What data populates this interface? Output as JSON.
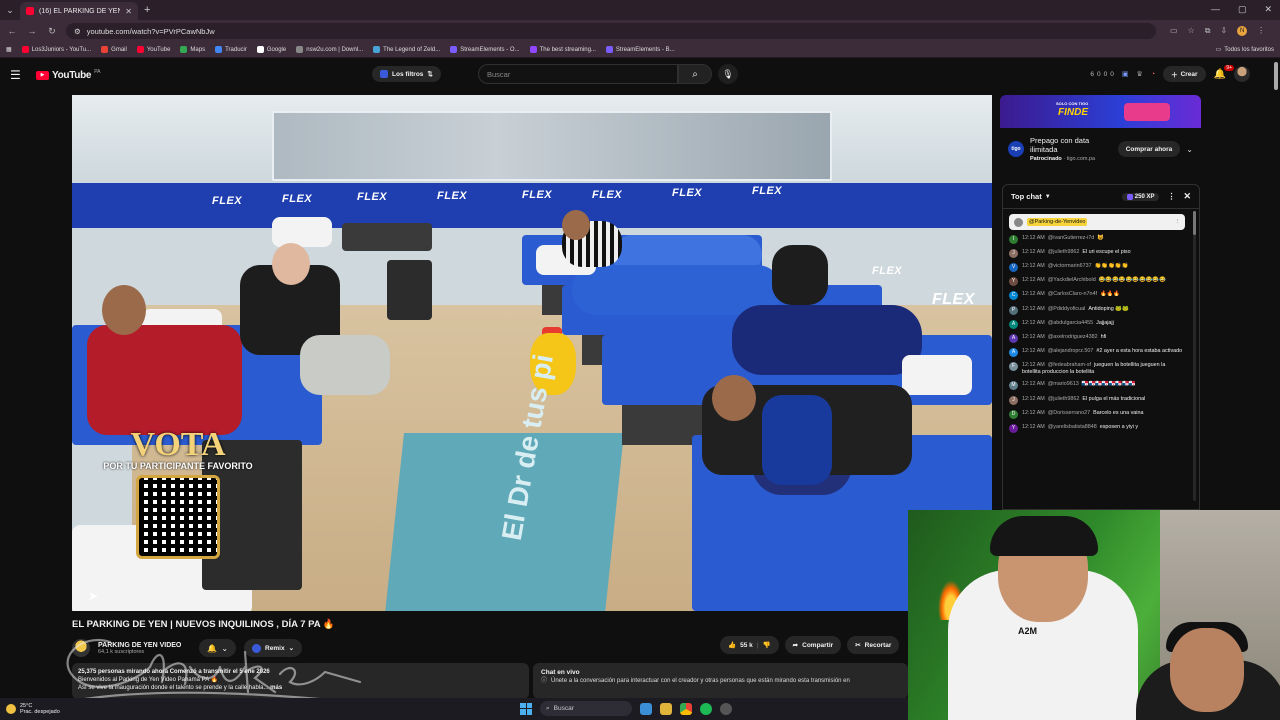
{
  "browser": {
    "tab_title": "(16) EL PARKING DE YEN | NUE",
    "url": "youtube.com/watch?v=PVrPCawNbJw",
    "bookmarks": [
      {
        "label": "Los3Juniors - YouTu...",
        "color": "#ff0033"
      },
      {
        "label": "Gmail",
        "color": "#ea4335"
      },
      {
        "label": "YouTube",
        "color": "#ff0033"
      },
      {
        "label": "Maps",
        "color": "#34a853"
      },
      {
        "label": "Traducir",
        "color": "#4285f4"
      },
      {
        "label": "Google",
        "color": "#ffffff"
      },
      {
        "label": "nsw2u.com | Downl...",
        "color": "#888888"
      },
      {
        "label": "The Legend of Zeld...",
        "color": "#4aa3d6"
      },
      {
        "label": "StreamElements - O...",
        "color": "#7b5cff"
      },
      {
        "label": "The best streaming...",
        "color": "#9146ff"
      },
      {
        "label": "StreamElements - B...",
        "color": "#7b5cff"
      }
    ],
    "bookmarks_right": "Todos los favoritos",
    "profile_letter": "N"
  },
  "yt": {
    "logo_text": "YouTube",
    "country_code": "PA",
    "filters_label": "Los filtros",
    "search_placeholder": "Buscar",
    "ext_stats": [
      "6",
      "0",
      "0",
      "0"
    ],
    "create_label": "Crear",
    "notif_count": "9+"
  },
  "player": {
    "vota_title": "VOTA",
    "vota_sub": "POR TU PARTICIPANTE FAVORITO",
    "rug_text": "El Dr de tus pi"
  },
  "ad": {
    "banner_tag": "SOLO CON TIGO",
    "banner_big": "FINDE",
    "title": "Prepago con data ilimitada",
    "sponsor_label": "Patrocinado",
    "domain": "tigo.com.pa",
    "cta": "Comprar ahora",
    "logo_text": "tigo"
  },
  "chat": {
    "mode": "Top chat",
    "xp": "250 XP",
    "pinned_name": "@Parking-de-Yenvideo",
    "messages": [
      {
        "time": "12:12 AM",
        "author": "@ivanGutierrez-i7d",
        "text": "😺",
        "color": "#2e7d32",
        "letter": "I"
      },
      {
        "time": "12:12 AM",
        "author": "@julieth9862",
        "text": "El uri escupe el piso",
        "color": "#8d6e63",
        "letter": "J"
      },
      {
        "time": "12:12 AM",
        "author": "@victormarin6737",
        "text": "👏👏👏👏👏",
        "color": "#1565c0",
        "letter": "V"
      },
      {
        "time": "12:12 AM",
        "author": "@YackdielArchibold",
        "text": "😂😂😂😂😂😂😂😂😂😂",
        "color": "#6d4c41",
        "letter": "Y"
      },
      {
        "time": "12:12 AM",
        "author": "@CarlosClaro-n7n4f",
        "text": "🔥🔥🔥",
        "color": "#0288d1",
        "letter": "C"
      },
      {
        "time": "12:12 AM",
        "author": "@Pdiddyoficual",
        "text": "Antidoping 🐸🐸",
        "color": "#546e7a",
        "letter": "P"
      },
      {
        "time": "12:12 AM",
        "author": "@abdulgarcia4455",
        "text": "Jajjajajj",
        "color": "#00897b",
        "letter": "A"
      },
      {
        "time": "12:12 AM",
        "author": "@axelrodriguez4382",
        "text": "hfi",
        "color": "#5e35b1",
        "letter": "A"
      },
      {
        "time": "12:12 AM",
        "author": "@alejandroprz.507",
        "text": "#2 ayer a esta hora estaba activado",
        "color": "#1e88e5",
        "letter": "A"
      },
      {
        "time": "12:12 AM",
        "author": "@fedeabraham-sf",
        "text": "jueguen la botellita jueguen la botellita produccion la botellita",
        "color": "#78909c",
        "letter": "F"
      },
      {
        "time": "12:12 AM",
        "author": "@mario9613",
        "text": "🇵🇦🇵🇦🇵🇦🇵🇦🇵🇦🇵🇦🇵🇦🇵🇦",
        "color": "#607d8b",
        "letter": "M"
      },
      {
        "time": "12:12 AM",
        "author": "@julieth9862",
        "text": "El pulga el más tradicional",
        "color": "#8d6e63",
        "letter": "J"
      },
      {
        "time": "12:12 AM",
        "author": "@Dorisserrano27",
        "text": "Barcelo es una vaina",
        "color": "#2e7d32",
        "letter": "D"
      },
      {
        "time": "12:12 AM",
        "author": "@yarelisbatista8848",
        "text": "esposen a yiyi y",
        "color": "#6a1b9a",
        "letter": "Y"
      }
    ]
  },
  "video": {
    "title": "EL PARKING DE YEN | NUEVOS INQUILINOS , DÍA 7 PA 🔥",
    "channel": "PARKING DE YEN VIDEO",
    "subs": "64,1 k suscriptores",
    "remix_label": "Remix",
    "likes": "55 k",
    "share_label": "Compartir",
    "clip_label": "Recortar",
    "desc_stats": "25,375 personas mirando ahora  Comenzó a transmitir el 5 ene 2026",
    "desc_line1": "Bienvenidos al Parking de Yen Video Panamá PA 🔥",
    "desc_line2": "Así se vive la inauguración donde el talento se prende y la calle habla...",
    "desc_more": "más",
    "chat_replay_title": "Chat en vivo",
    "chat_replay_body": "Únete a la conversación para interactuar con el creador y otras personas que están mirando esta transmisión en"
  },
  "webcam": {
    "shirt_text": "A2M"
  },
  "taskbar": {
    "temp": "25°C",
    "weather_desc": "Prac. despejado",
    "search": "Buscar"
  },
  "watermark_text": "Chukyex"
}
